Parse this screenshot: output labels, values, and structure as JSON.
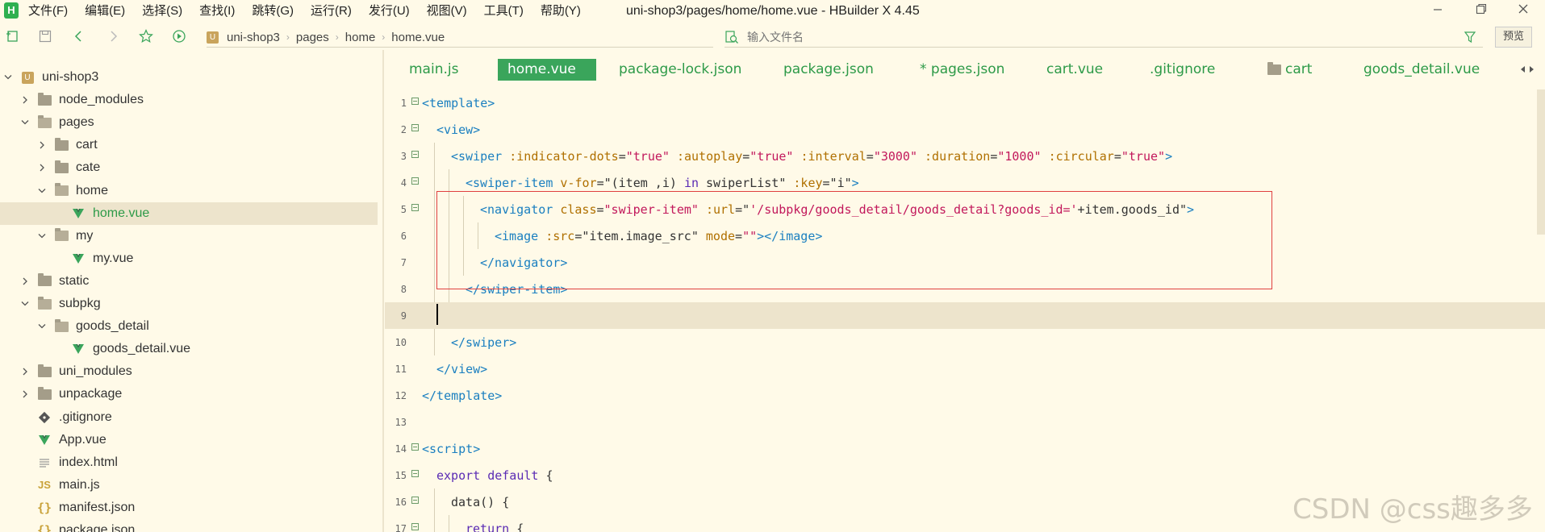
{
  "app": {
    "logo": "H",
    "window_title": "uni-shop3/pages/home/home.vue - HBuilder X 4.45"
  },
  "menu": [
    {
      "label": "文件(F)"
    },
    {
      "label": "编辑(E)"
    },
    {
      "label": "选择(S)"
    },
    {
      "label": "查找(I)"
    },
    {
      "label": "跳转(G)"
    },
    {
      "label": "运行(R)"
    },
    {
      "label": "发行(U)"
    },
    {
      "label": "视图(V)"
    },
    {
      "label": "工具(T)"
    },
    {
      "label": "帮助(Y)"
    }
  ],
  "toolbar": {
    "breadcrumb": [
      "uni-shop3",
      "pages",
      "home",
      "home.vue"
    ],
    "file_search_placeholder": "输入文件名",
    "preview_label": "预览"
  },
  "sidebar": {
    "items": [
      {
        "label": "uni-shop3",
        "level": 0,
        "chevron": "down",
        "icon": "project-icon"
      },
      {
        "label": "node_modules",
        "level": 1,
        "chevron": "right",
        "icon": "folder-icon"
      },
      {
        "label": "pages",
        "level": 1,
        "chevron": "down",
        "icon": "folder-open-icon"
      },
      {
        "label": "cart",
        "level": 2,
        "chevron": "right",
        "icon": "folder-icon"
      },
      {
        "label": "cate",
        "level": 2,
        "chevron": "right",
        "icon": "folder-icon"
      },
      {
        "label": "home",
        "level": 2,
        "chevron": "down",
        "icon": "folder-open-icon"
      },
      {
        "label": "home.vue",
        "level": 3,
        "chevron": "",
        "icon": "vue-file-icon",
        "selected": true
      },
      {
        "label": "my",
        "level": 2,
        "chevron": "down",
        "icon": "folder-open-icon"
      },
      {
        "label": "my.vue",
        "level": 3,
        "chevron": "",
        "icon": "vue-file-icon"
      },
      {
        "label": "static",
        "level": 1,
        "chevron": "right",
        "icon": "folder-icon"
      },
      {
        "label": "subpkg",
        "level": 1,
        "chevron": "down",
        "icon": "folder-open-icon"
      },
      {
        "label": "goods_detail",
        "level": 2,
        "chevron": "down",
        "icon": "folder-open-icon"
      },
      {
        "label": "goods_detail.vue",
        "level": 3,
        "chevron": "",
        "icon": "vue-file-icon"
      },
      {
        "label": "uni_modules",
        "level": 1,
        "chevron": "right",
        "icon": "folder-icon"
      },
      {
        "label": "unpackage",
        "level": 1,
        "chevron": "right",
        "icon": "folder-icon"
      },
      {
        "label": ".gitignore",
        "level": 1,
        "chevron": "",
        "icon": "git-file-icon"
      },
      {
        "label": "App.vue",
        "level": 1,
        "chevron": "",
        "icon": "vue-file-icon"
      },
      {
        "label": "index.html",
        "level": 1,
        "chevron": "",
        "icon": "html-file-icon"
      },
      {
        "label": "main.js",
        "level": 1,
        "chevron": "",
        "icon": "js-file-icon"
      },
      {
        "label": "manifest.json",
        "level": 1,
        "chevron": "",
        "icon": "json-file-icon"
      },
      {
        "label": "package.json",
        "level": 1,
        "chevron": "",
        "icon": "json-file-icon"
      }
    ]
  },
  "tabs": [
    {
      "label": "main.js"
    },
    {
      "label": "home.vue",
      "active": true
    },
    {
      "label": "package-lock.json"
    },
    {
      "label": "package.json"
    },
    {
      "label": "* pages.json"
    },
    {
      "label": "cart.vue"
    },
    {
      "label": ".gitignore"
    },
    {
      "label": "cart",
      "icon": "folder-icon"
    },
    {
      "label": "goods_detail.vue"
    }
  ],
  "editor": {
    "lines": [
      {
        "n": "1",
        "fold": true,
        "indent": 0,
        "tokens": [
          [
            "tg",
            "<template>"
          ]
        ]
      },
      {
        "n": "2",
        "fold": true,
        "indent": 1,
        "tokens": [
          [
            "tg",
            "<view>"
          ]
        ]
      },
      {
        "n": "3",
        "fold": true,
        "indent": 2,
        "tokens": [
          [
            "tg",
            "<swiper"
          ],
          [
            "pl",
            " "
          ],
          [
            "at",
            ":indicator-dots"
          ],
          [
            "pl",
            "="
          ],
          [
            "st",
            "\"true\""
          ],
          [
            "pl",
            " "
          ],
          [
            "at",
            ":autoplay"
          ],
          [
            "pl",
            "="
          ],
          [
            "st",
            "\"true\""
          ],
          [
            "pl",
            " "
          ],
          [
            "at",
            ":interval"
          ],
          [
            "pl",
            "="
          ],
          [
            "st",
            "\"3000\""
          ],
          [
            "pl",
            " "
          ],
          [
            "at",
            ":duration"
          ],
          [
            "pl",
            "="
          ],
          [
            "st",
            "\"1000\""
          ],
          [
            "pl",
            " "
          ],
          [
            "at",
            ":circular"
          ],
          [
            "pl",
            "="
          ],
          [
            "st",
            "\"true\""
          ],
          [
            "tg",
            ">"
          ]
        ]
      },
      {
        "n": "4",
        "fold": true,
        "indent": 3,
        "tokens": [
          [
            "tg",
            "<swiper-item"
          ],
          [
            "pl",
            " "
          ],
          [
            "at",
            "v-for"
          ],
          [
            "pl",
            "=\"(item ,i) "
          ],
          [
            "ky",
            "in"
          ],
          [
            "pl",
            " swiperList\" "
          ],
          [
            "at",
            ":key"
          ],
          [
            "pl",
            "=\"i\""
          ],
          [
            "tg",
            ">"
          ]
        ]
      },
      {
        "n": "5",
        "fold": true,
        "indent": 4,
        "tokens": [
          [
            "tg",
            "<navigator"
          ],
          [
            "pl",
            " "
          ],
          [
            "at",
            "class"
          ],
          [
            "pl",
            "="
          ],
          [
            "st",
            "\"swiper-item\""
          ],
          [
            "pl",
            " "
          ],
          [
            "at",
            ":url"
          ],
          [
            "pl",
            "=\""
          ],
          [
            "st",
            "'/subpkg/goods_detail/goods_detail?goods_id='"
          ],
          [
            "pl",
            "+item.goods_id\""
          ],
          [
            "tg",
            ">"
          ]
        ]
      },
      {
        "n": "6",
        "fold": false,
        "indent": 5,
        "tokens": [
          [
            "tg",
            "<image"
          ],
          [
            "pl",
            " "
          ],
          [
            "at",
            ":src"
          ],
          [
            "pl",
            "=\"item.image_src\" "
          ],
          [
            "at",
            "mode"
          ],
          [
            "pl",
            "="
          ],
          [
            "st",
            "\"\""
          ],
          [
            "tg",
            "></image>"
          ]
        ]
      },
      {
        "n": "7",
        "fold": false,
        "indent": 4,
        "tokens": [
          [
            "tg",
            "</navigator>"
          ]
        ]
      },
      {
        "n": "8",
        "fold": false,
        "indent": 3,
        "tokens": [
          [
            "tg",
            "</swiper-item>"
          ]
        ]
      },
      {
        "n": "9",
        "fold": false,
        "indent": 0,
        "current": true,
        "tokens": []
      },
      {
        "n": "10",
        "fold": false,
        "indent": 2,
        "tokens": [
          [
            "tg",
            "</swiper>"
          ]
        ]
      },
      {
        "n": "11",
        "fold": false,
        "indent": 1,
        "tokens": [
          [
            "tg",
            "</view>"
          ]
        ]
      },
      {
        "n": "12",
        "fold": false,
        "indent": 0,
        "tokens": [
          [
            "tg",
            "</template>"
          ]
        ]
      },
      {
        "n": "13",
        "fold": false,
        "indent": 0,
        "tokens": []
      },
      {
        "n": "14",
        "fold": true,
        "indent": 0,
        "tokens": [
          [
            "tg",
            "<script>"
          ]
        ]
      },
      {
        "n": "15",
        "fold": true,
        "indent": 1,
        "tokens": [
          [
            "ky",
            "export default"
          ],
          [
            "pl",
            " {"
          ]
        ]
      },
      {
        "n": "16",
        "fold": true,
        "indent": 2,
        "tokens": [
          [
            "pl",
            "data() {"
          ]
        ]
      },
      {
        "n": "17",
        "fold": true,
        "indent": 3,
        "tokens": [
          [
            "ky",
            "return"
          ],
          [
            "pl",
            " {"
          ]
        ]
      }
    ]
  },
  "watermark": "CSDN @css趣多多",
  "colors": {
    "background": "#fffae8",
    "accent_green": "#2d9a48",
    "active_tab": "#3aa55b",
    "highlight_box": "#e0403f"
  }
}
